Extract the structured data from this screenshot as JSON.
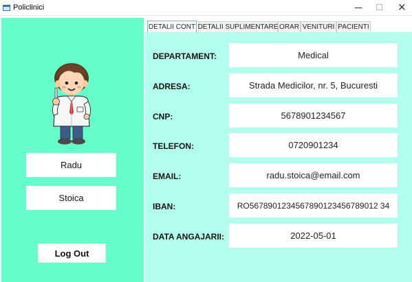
{
  "window": {
    "title": "Policlinici",
    "minimize_glyph": "",
    "close_glyph": "×"
  },
  "user": {
    "first_name": "Radu",
    "last_name": "Stoica",
    "logout_label": "Log Out",
    "avatar_icon": "doctor-avatar-icon"
  },
  "tabs": [
    {
      "label": "DETALII CONT",
      "active": true
    },
    {
      "label": "DETALII SUPLIMENTARE",
      "active": false
    },
    {
      "label": "ORAR",
      "active": false
    },
    {
      "label": "VENITURI",
      "active": false
    },
    {
      "label": "PACIENTI",
      "active": false
    }
  ],
  "account": {
    "rows": [
      {
        "label": "DEPARTAMENT:",
        "value": "Medical"
      },
      {
        "label": "ADRESA:",
        "value": "Strada Medicilor, nr. 5, Bucuresti"
      },
      {
        "label": "CNP:",
        "value": "5678901234567"
      },
      {
        "label": "TELEFON:",
        "value": "0720901234"
      },
      {
        "label": "EMAIL:",
        "value": "radu.stoica@email.com"
      },
      {
        "label": "IBAN:",
        "value": "RO5678901234567890123456789012 34"
      },
      {
        "label": "DATA ANGAJARII:",
        "value": "2022-05-01"
      }
    ]
  },
  "colors": {
    "left_panel": "#66ffcc",
    "content_bg": "#b3ffee"
  }
}
